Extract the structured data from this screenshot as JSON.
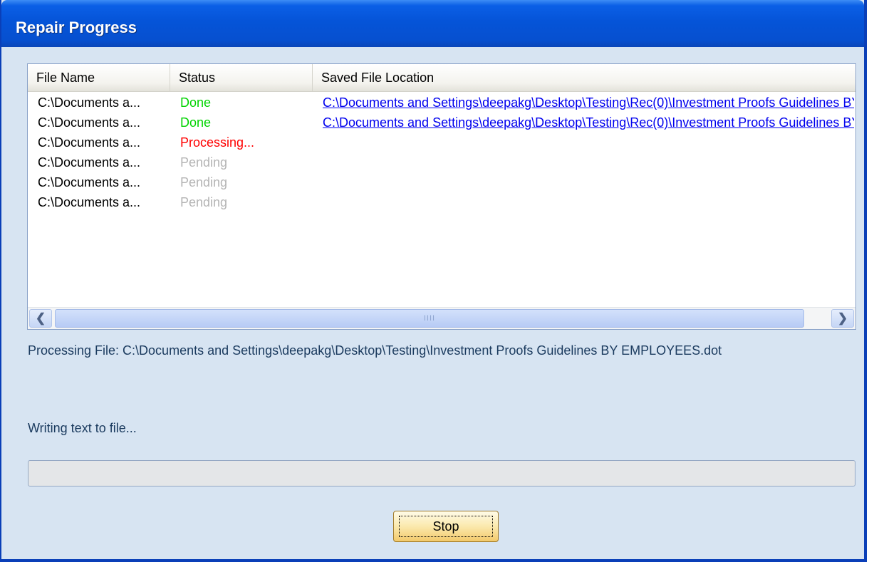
{
  "window": {
    "title": "Repair Progress"
  },
  "listview": {
    "columns": [
      "File Name",
      "Status",
      "Saved File Location"
    ],
    "rows": [
      {
        "file": "C:\\Documents a...",
        "status": "Done",
        "status_color": "#00d400",
        "location": "C:\\Documents and Settings\\deepakg\\Desktop\\Testing\\Rec(0)\\Investment Proofs Guidelines BY EMPLOYEES.doc"
      },
      {
        "file": "C:\\Documents a...",
        "status": "Done",
        "status_color": "#00d400",
        "location": "C:\\Documents and Settings\\deepakg\\Desktop\\Testing\\Rec(0)\\Investment Proofs Guidelines BY EMPLOYEES.docx"
      },
      {
        "file": "C:\\Documents a...",
        "status": "Processing...",
        "status_color": "#ff0000",
        "location": ""
      },
      {
        "file": "C:\\Documents a...",
        "status": "Pending",
        "status_color": "#b4b4b4",
        "location": ""
      },
      {
        "file": "C:\\Documents a...",
        "status": "Pending",
        "status_color": "#b4b4b4",
        "location": ""
      },
      {
        "file": "C:\\Documents a...",
        "status": "Pending",
        "status_color": "#b4b4b4",
        "location": ""
      }
    ],
    "scrollbar": {
      "thumb_grip": "IIII"
    }
  },
  "processing_file": "Processing File: C:\\Documents and Settings\\deepakg\\Desktop\\Testing\\Investment Proofs Guidelines BY EMPLOYEES.dot",
  "status_text": "Writing text to file...",
  "progress": {
    "value": 0
  },
  "buttons": {
    "stop": "Stop"
  },
  "colors": {
    "title_bar": "#0554d8",
    "dialog_bg": "#d7e4f2",
    "link": "#0000ee"
  },
  "icons": {
    "scroll_left": "chevron-left-icon",
    "scroll_right": "chevron-right-icon"
  }
}
